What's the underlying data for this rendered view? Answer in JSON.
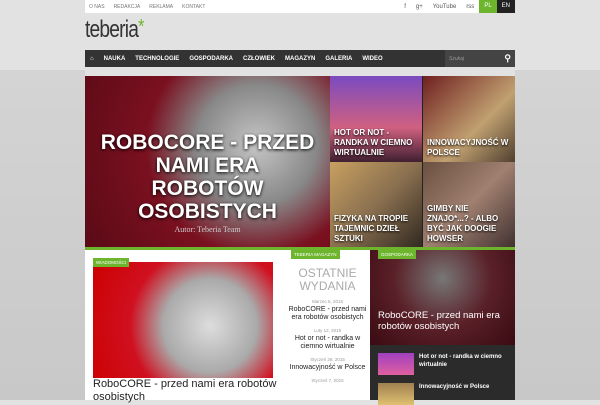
{
  "topbar": {
    "links": [
      "O NAS",
      "REDAKCJA",
      "REKLAMA",
      "KONTAKT"
    ],
    "social": [
      "f",
      "g+",
      "YouTube",
      "rss"
    ],
    "lang": [
      "PL",
      "EN"
    ]
  },
  "logo": "teberia",
  "nav": {
    "items": [
      "NAUKA",
      "TECHNOLOGIE",
      "GOSPODARKA",
      "CZŁOWIEK",
      "MAGAZYN",
      "GALERIA",
      "WIDEO"
    ],
    "search_placeholder": "Szukaj"
  },
  "hero": {
    "title": "ROBOCORE - PRZED NAMI ERA ROBOTÓW OSOBISTYCH",
    "author": "Autor: Teberia Team",
    "tiles": [
      "HOT OR NOT - RANDKA W CIEMNO WIRTUALNIE",
      "INNOWACYJNOŚĆ W POLSCE",
      "FIZYKA NA TROPIE TAJEMNIC DZIEŁ SZTUKI",
      "GIMBY NIE ZNAJO*...? - ALBO BYĆ JAK DOOGIE HOWSER"
    ]
  },
  "col1": {
    "tag": "WIADOMOŚCI",
    "title": "RoboCORE - przed nami era robotów osobistych"
  },
  "col2": {
    "tag": "TEBERIA MAGAZYN",
    "heading": "OSTATNIE WYDANIA",
    "issues": [
      {
        "date": "Marzec 5, 2015",
        "title": "RoboCORE - przed nami era robotów osobistych"
      },
      {
        "date": "Luty 12, 2015",
        "title": "Hot or not - randka w ciemno wirtualnie"
      },
      {
        "date": "Styczeń 28, 2015",
        "title": "Innowacyjność w Polsce"
      },
      {
        "date": "Styczeń 7, 2015",
        "title": ""
      }
    ]
  },
  "col3": {
    "tag": "GOSPODARKA",
    "title": "RoboCORE - przed nami era robotów osobistych",
    "items": [
      "Hot or not - randka w ciemno wirtualnie",
      "Innowacyjność w Polsce"
    ]
  }
}
